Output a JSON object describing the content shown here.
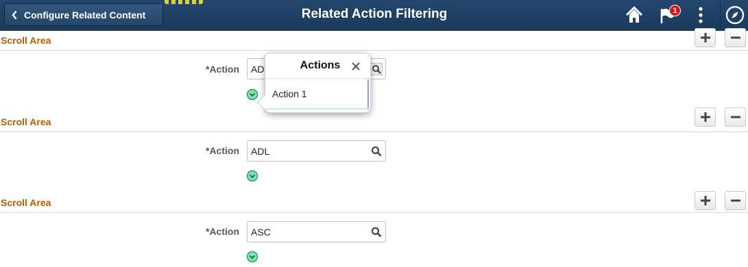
{
  "banner": {
    "back_label": "Configure Related Content",
    "title": "Related Action Filtering",
    "notification_count": "1",
    "icons": {
      "back": "chevron-left-icon",
      "home": "home-icon",
      "notifications": "flag-icon",
      "actions": "vertical-ellipsis-icon",
      "navbar": "compass-icon"
    },
    "colors": {
      "background": "#1b3a5c",
      "badge": "#d31b1b"
    }
  },
  "scroll_areas": [
    {
      "title": "Scroll Area",
      "field_label": "*Action",
      "field_value": "ADL"
    },
    {
      "title": "Scroll Area",
      "field_label": "*Action",
      "field_value": "ADL"
    },
    {
      "title": "Scroll Area",
      "field_label": "*Action",
      "field_value": "ASC"
    }
  ],
  "row_buttons": {
    "add_icon": "plus-icon",
    "delete_icon": "minus-icon"
  },
  "popup": {
    "title": "Actions",
    "items": [
      "Action 1"
    ],
    "close_icon": "close-icon"
  },
  "colors": {
    "section_title": "#b05c00",
    "expand_icon": "#2f9e6e"
  }
}
